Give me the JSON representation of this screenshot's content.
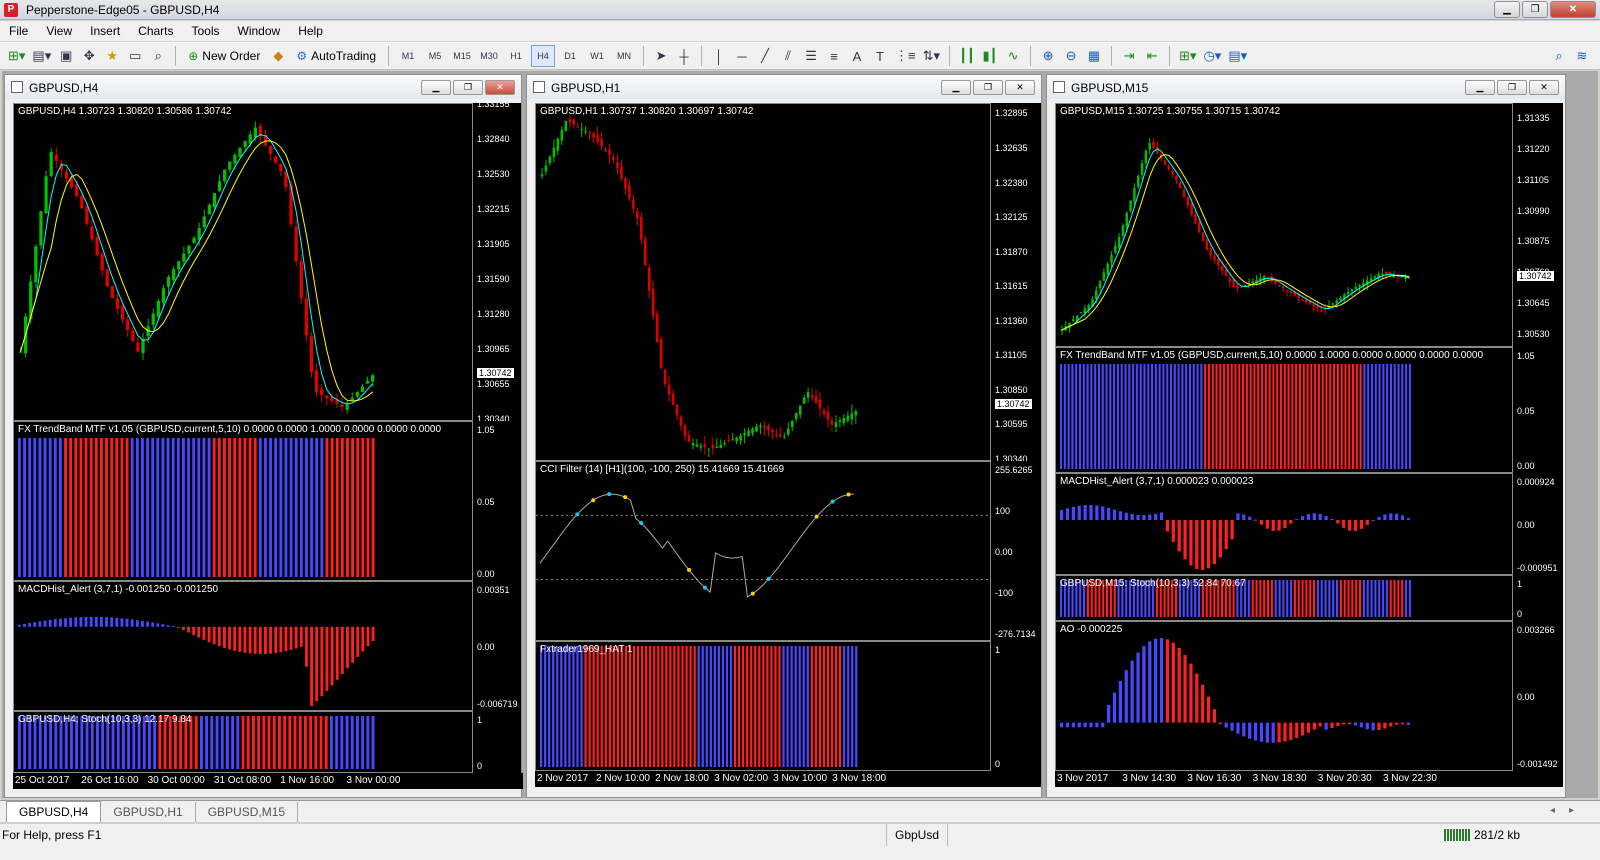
{
  "app": {
    "title": "Pepperstone-Edge05 - GBPUSD,H4"
  },
  "menu": [
    "File",
    "View",
    "Insert",
    "Charts",
    "Tools",
    "Window",
    "Help"
  ],
  "toolbar": {
    "new_order": "New Order",
    "autotrading": "AutoTrading",
    "timeframes": [
      "M1",
      "M5",
      "M15",
      "M30",
      "H1",
      "H4",
      "D1",
      "W1",
      "MN"
    ],
    "active_timeframe": "H4"
  },
  "colors": {
    "bull": "#00c000",
    "bear": "#e00000",
    "blue_bar": "#4848ff",
    "red_bar": "#ff2020",
    "ma_fast": "#00ffff",
    "ma_slow": "#ffff00"
  },
  "windows": [
    {
      "title": "GBPUSD,H4",
      "ohlc": "GBPUSD,H4  1.30723 1.30820 1.30586 1.30742",
      "price_ticks": [
        "1.33155",
        "1.32840",
        "1.32530",
        "1.32215",
        "1.31905",
        "1.31590",
        "1.31280",
        "1.30965",
        "1.30655",
        "1.30340"
      ],
      "price_range": [
        1.3034,
        1.3316
      ],
      "current_price": "1.30742",
      "panes": [
        {
          "label": "FX TrendBand MTF v1.05 (GBPUSD,current,5,10) 0.0000 0.0000 1.0000 0.0000 0.0000 0.0000",
          "scale": [
            "1.05",
            "0.05",
            "0.00"
          ],
          "pattern": "bbbbbbbbbrrrrrrrrrrrrrbbbbbbbbbbbbbbbbrrrrrrrrrbbbbbbbbbbbbbrrrrrrrrrr"
        },
        {
          "label": "MACDHist_Alert (3,7,1)  -0.001250 -0.001250",
          "scale": [
            "0.00351",
            "0.00",
            "-0.006719"
          ]
        },
        {
          "label": "GBPUSD,H4: Stoch(10,3,3) 12.17 9.84",
          "scale": [
            "1",
            "0"
          ],
          "pattern": "bbbbbbbbbbbbbbbbbbbbbbbbbbbrrrrrrrrbbbbbbbbrrrrrrrrrrrrrrrrrbbbbbbbbb"
        }
      ],
      "time_ticks": [
        "25 Oct 2017",
        "26 Oct 16:00",
        "30 Oct 00:00",
        "31 Oct 08:00",
        "1 Nov 16:00",
        "3 Nov 00:00"
      ]
    },
    {
      "title": "GBPUSD,H1",
      "ohlc": "GBPUSD,H1  1.30737 1.30820 1.30697 1.30742",
      "price_ticks": [
        "1.32895",
        "1.32635",
        "1.32380",
        "1.32125",
        "1.31870",
        "1.31615",
        "1.31360",
        "1.31105",
        "1.30850",
        "1.30595",
        "1.30340"
      ],
      "price_range": [
        1.3034,
        1.3297
      ],
      "current_price": "1.30742",
      "panes": [
        {
          "label": "CCI Filter (14) [H1](100, -100, 250) 15.41669 15.41669",
          "scale": [
            "255.6265",
            "100",
            "0.00",
            "-100",
            "-276.7134"
          ]
        },
        {
          "label": "Fxtrader1969_HAT 1",
          "scale": [
            "1",
            "0"
          ],
          "pattern": "bbbbbbbbbbbrrrrrrrrrrrrrrrrrrrrrrrrrrrrbbbbbbbbbrrrrrrrrrrrrbbbbbbbrrrrrrrrbbbb"
        }
      ],
      "time_ticks": [
        "2 Nov 2017",
        "2 Nov 10:00",
        "2 Nov 18:00",
        "3 Nov 02:00",
        "3 Nov 10:00",
        "3 Nov 18:00"
      ]
    },
    {
      "title": "GBPUSD,M15",
      "ohlc": "GBPUSD,M15  1.30725 1.30755 1.30715 1.30742",
      "price_ticks": [
        "1.31335",
        "1.31220",
        "1.31105",
        "1.30990",
        "1.30875",
        "1.30760",
        "1.30645",
        "1.30530"
      ],
      "price_range": [
        1.3049,
        1.3139
      ],
      "current_price": "1.30742",
      "panes": [
        {
          "label": "FX TrendBand MTF v1.05 (GBPUSD,current,5,10) 0.0000 1.0000 0.0000 0.0000 0.0000 0.0000",
          "scale": [
            "1.05",
            "0.05",
            "0.00"
          ],
          "pattern": "bbbbbbbbbbbbbbbbbbbbbbbbbbbbbbbbbbbbbbrrrrrrrrrrrrrrrrrrrrrrrrrrrrrrrrrrrrrrrrrrbbbbbbbbbbbbb"
        },
        {
          "label": "MACDHist_Alert (3,7,1)  0.000023 0.000023",
          "scale": [
            "0.000924",
            "0.00",
            "-0.000951"
          ]
        },
        {
          "label": "GBPUSD,M15: Stoch(10,3,3) 52.84 70.67",
          "scale": [
            "1",
            "0"
          ],
          "pattern": "bbbbbbbrrrrrrrrbbbbbbbbbbrrrrrrbbbbbbrrrrrrrrrbbbbrrrrrrbbbbbrrrrrrbbbbbbrrrrrrbbbbbbbrrrrbb"
        },
        {
          "label": "AO -0.000225",
          "scale": [
            "0.003266",
            "0.00",
            "-0.001492"
          ]
        }
      ],
      "time_ticks": [
        "3 Nov 2017",
        "3 Nov 14:30",
        "3 Nov 16:30",
        "3 Nov 18:30",
        "3 Nov 20:30",
        "3 Nov 22:30"
      ]
    }
  ],
  "tabs": [
    "GBPUSD,H4",
    "GBPUSD,H1",
    "GBPUSD,M15"
  ],
  "active_tab": "GBPUSD,H4",
  "status": {
    "help": "For Help, press F1",
    "profile": "GbpUsd",
    "traffic": "281/2 kb"
  }
}
